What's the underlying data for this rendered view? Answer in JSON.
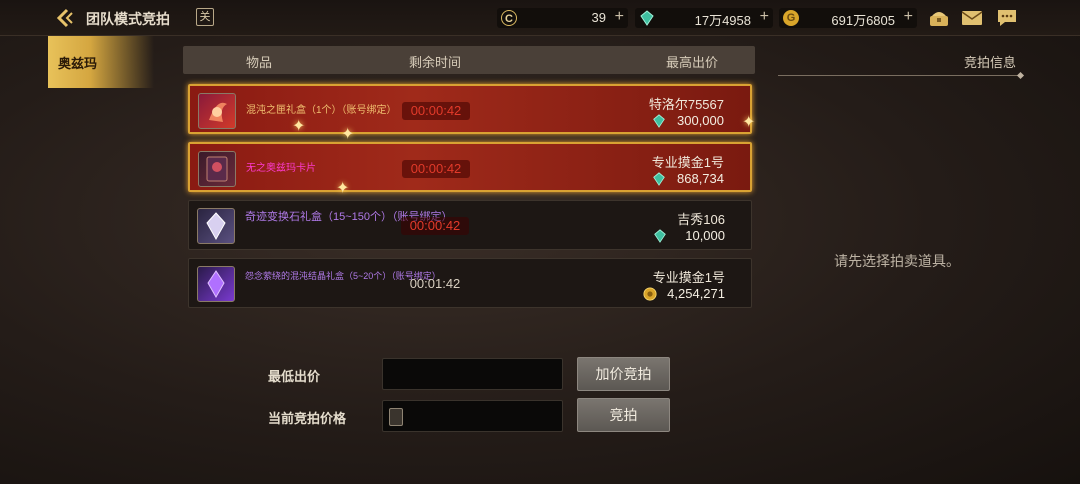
{
  "header": {
    "title": "团队模式竞拍",
    "calendar_glyph": "关",
    "currencies": [
      {
        "name": "c-coin",
        "value": "39",
        "color": "#d9b860"
      },
      {
        "name": "gem",
        "value": "17万4958",
        "color": "#3fbfa0"
      },
      {
        "name": "gold",
        "value": "691万6805",
        "color": "#e0b030"
      }
    ]
  },
  "sidebar": {
    "tab_label": "奥兹玛"
  },
  "list": {
    "columns": {
      "item": "物品",
      "time": "剩余时间",
      "bid": "最高出价"
    },
    "rows": [
      {
        "name": "混沌之匣礼盒（1个）（账号绑定）",
        "name_color": "#f0c070",
        "time": "00:00:42",
        "bidder": "特洛尔75567",
        "price": "300,000",
        "price_currency": "gem",
        "selected": true
      },
      {
        "name": "无之奥兹玛卡片",
        "name_color": "#ff3ad0",
        "time": "00:00:42",
        "bidder": "专业摸金1号",
        "price": "868,734",
        "price_currency": "gem",
        "selected": true
      },
      {
        "name": "奇迹变换石礼盒（15~150个）（账号绑定）",
        "name_color": "#b07ae8",
        "time": "00:00:42",
        "bidder": "吉秀106",
        "price": "10,000",
        "price_currency": "gem",
        "selected": false
      },
      {
        "name": "怨念萦绕的混沌结晶礼盒（5~20个）（账号绑定）",
        "name_color": "#b07ae8",
        "time": "00:01:42",
        "bidder": "专业摸金1号",
        "price": "4,254,271",
        "price_currency": "gold",
        "selected": false
      }
    ]
  },
  "info": {
    "title": "竞拍信息",
    "hint": "请先选择拍卖道具。"
  },
  "form": {
    "min_bid_label": "最低出价",
    "min_bid_value": "",
    "current_bid_label": "当前竞拍价格",
    "current_bid_value": "",
    "raise_button": "加价竞拍",
    "bid_button": "竞拍"
  }
}
